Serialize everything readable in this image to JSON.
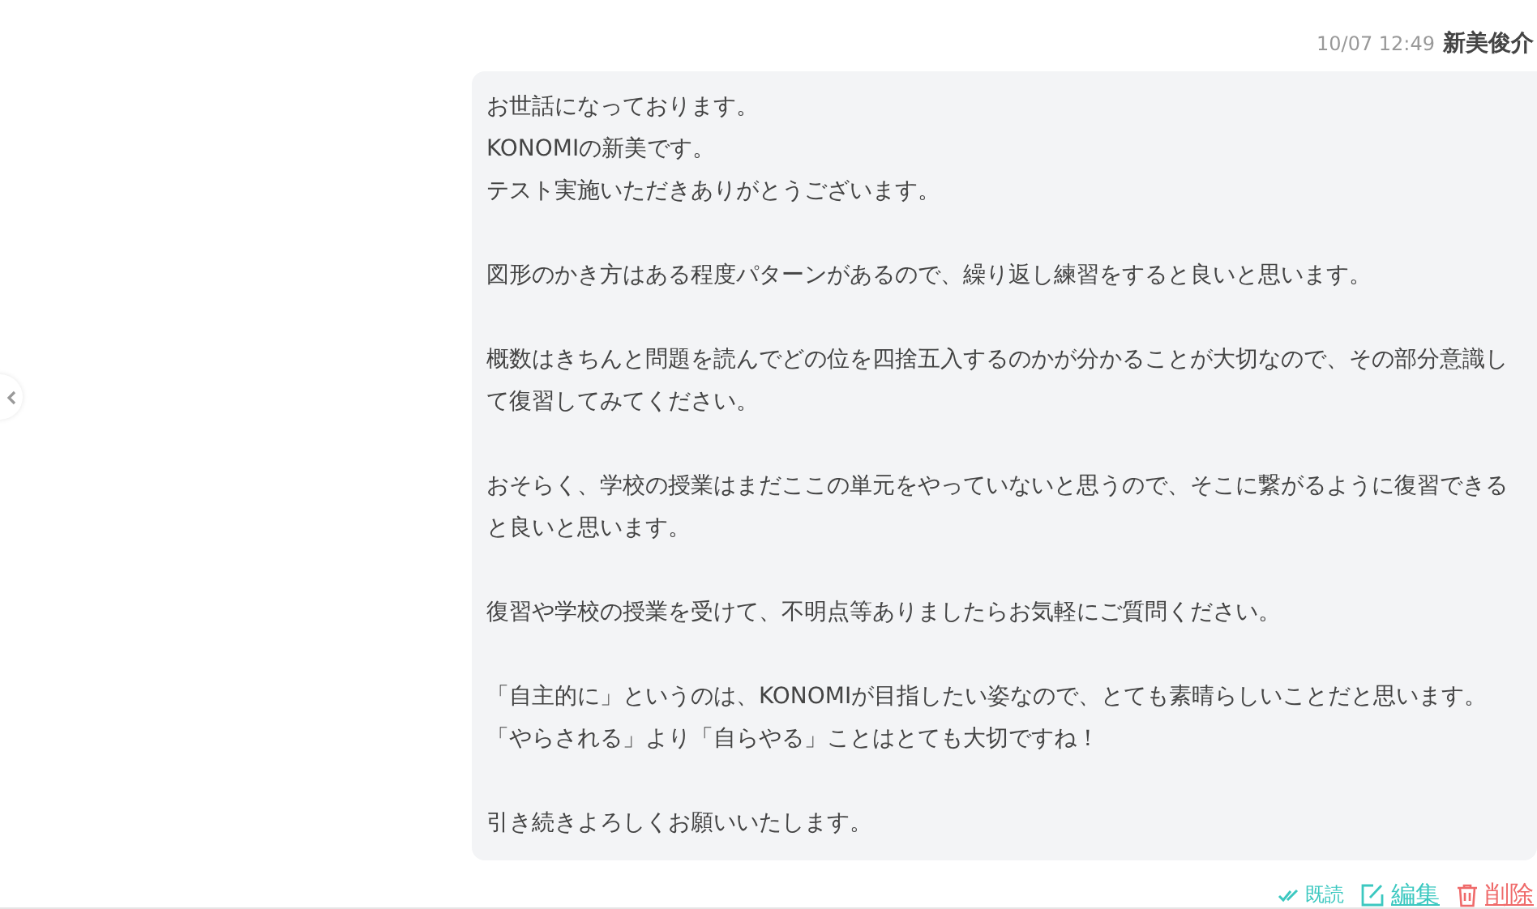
{
  "message": {
    "time": "10/07 12:49",
    "sender": "新美俊介",
    "paragraphs": [
      [
        "お世話になっております。",
        "KONOMIの新美です。",
        "テスト実施いただきありがとうございます。"
      ],
      "図形のかき方はある程度パターンがあるので、繰り返し練習をすると良いと思います。",
      "概数はきちんと問題を読んでどの位を四捨五入するのかが分かることが大切なので、その部分意識して復習してみてください。",
      "おそらく、学校の授業はまだここの単元をやっていないと思うので、そこに繋がるように復習できると良いと思います。",
      "復習や学校の授業を受けて、不明点等ありましたらお気軽にご質問ください。",
      "「自主的に」というのは、KONOMIが目指したい姿なので、とても素晴らしいことだと思います。「やらされる」より「自らやる」ことはとても大切ですね！",
      "引き続きよろしくお願いいたします。"
    ],
    "read_label": "既読",
    "edit_label": "編集",
    "delete_label": "削除"
  }
}
